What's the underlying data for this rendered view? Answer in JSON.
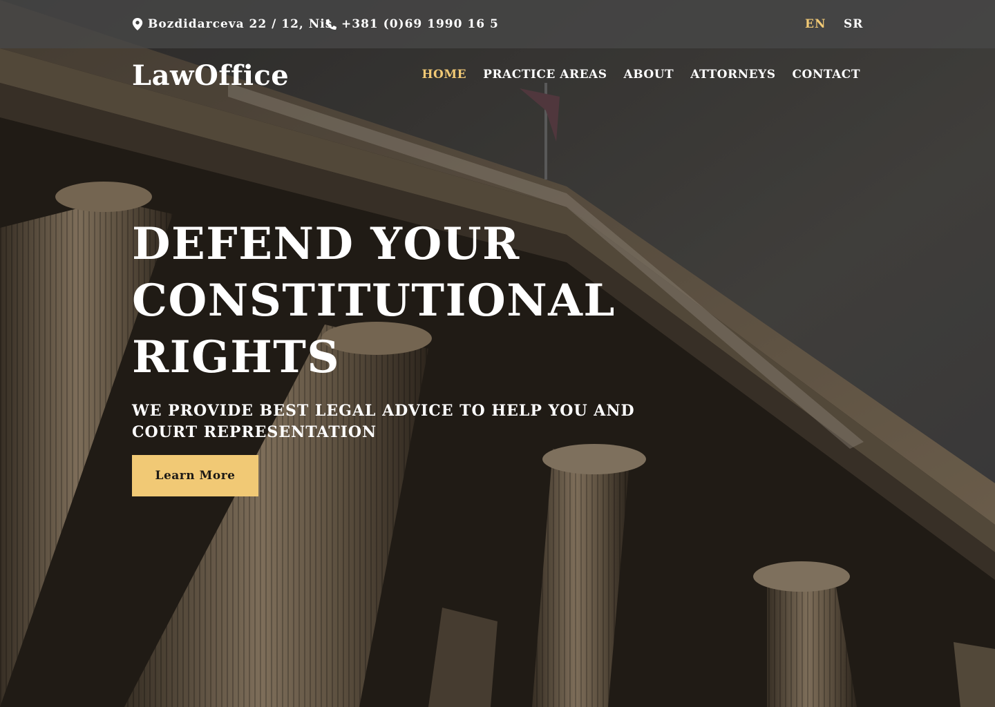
{
  "colors": {
    "accent": "#f1c975",
    "topbar": "#484848"
  },
  "topbar": {
    "address": "Bozdidarceva 22 / 12, Nis",
    "address_icon": "map-pin-icon",
    "phone": "+381 (0)69 1990 16 5",
    "phone_icon": "phone-icon",
    "languages": [
      {
        "label": "EN",
        "active": true
      },
      {
        "label": "SR",
        "active": false
      }
    ]
  },
  "brand": {
    "logo": "LawOffice"
  },
  "nav": {
    "items": [
      {
        "label": "HOME",
        "active": true
      },
      {
        "label": "PRACTICE AREAS",
        "active": false
      },
      {
        "label": "ABOUT",
        "active": false
      },
      {
        "label": "ATTORNEYS",
        "active": false
      },
      {
        "label": "CONTACT",
        "active": false
      }
    ]
  },
  "hero": {
    "title_lines": [
      "DEFEND YOUR",
      "CONSTITUTIONAL",
      "RIGHTS"
    ],
    "subtitle": "WE PROVIDE BEST LEGAL ADVICE TO HELP YOU AND COURT REPRESENTATION",
    "cta_label": "Learn More",
    "background": "courthouse-columns-image"
  }
}
